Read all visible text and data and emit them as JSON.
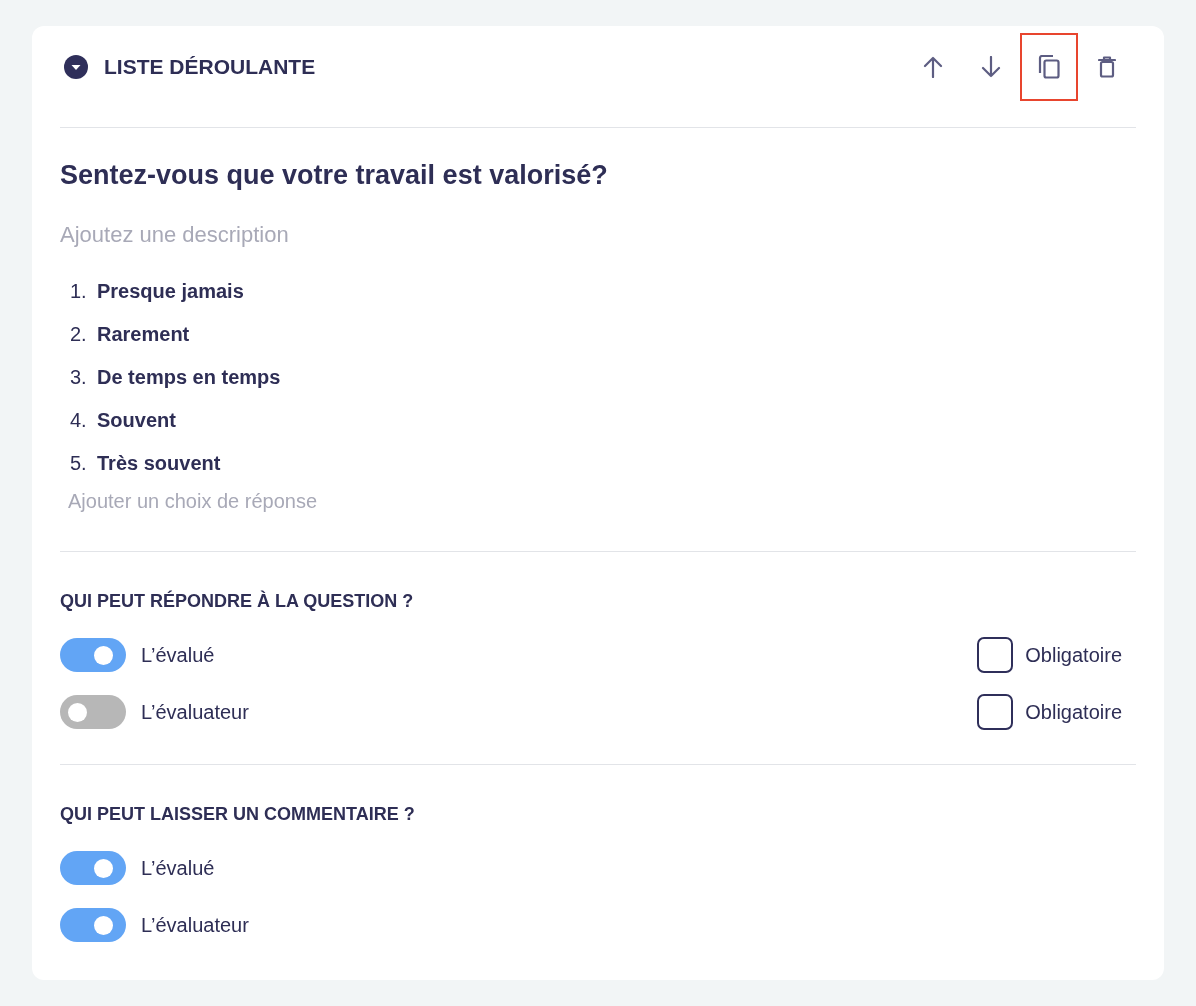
{
  "card": {
    "header": {
      "title": "LISTE DÉROULANTE",
      "actions": [
        {
          "kind": "up",
          "highlighted": false
        },
        {
          "kind": "down",
          "highlighted": false
        },
        {
          "kind": "copy",
          "highlighted": true
        },
        {
          "kind": "delete",
          "highlighted": false
        }
      ]
    },
    "question": {
      "title": "Sentez-vous que votre travail est valorisé?",
      "description": {
        "placeholder": "Ajoutez une description"
      },
      "choices": [
        {
          "number": "1.",
          "label": "Presque jamais"
        },
        {
          "number": "2.",
          "label": "Rarement"
        },
        {
          "number": "3.",
          "label": "De temps en temps"
        },
        {
          "number": "4.",
          "label": "Souvent"
        },
        {
          "number": "5.",
          "label": "Très souvent"
        }
      ],
      "new_choice": {
        "placeholder": "Ajouter un choix de réponse"
      }
    },
    "sections": [
      {
        "title": "QUI PEUT RÉPONDRE À LA QUESTION ?",
        "rows": [
          {
            "label": "L’évalué",
            "on": true,
            "required": {
              "label": "Obligatoire",
              "checked": false
            }
          },
          {
            "label": "L’évaluateur",
            "on": false,
            "required": {
              "label": "Obligatoire",
              "checked": false
            }
          }
        ]
      },
      {
        "title": "QUI PEUT LAISSER UN COMMENTAIRE ?",
        "rows": [
          {
            "label": "L’évalué",
            "on": true
          },
          {
            "label": "L’évaluateur",
            "on": true
          }
        ]
      }
    ]
  }
}
